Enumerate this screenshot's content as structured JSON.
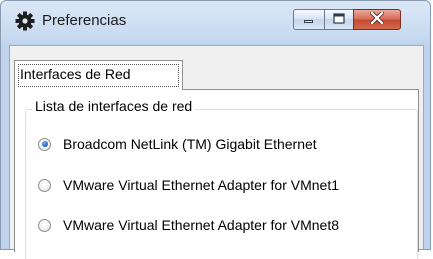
{
  "window": {
    "title": "Preferencias",
    "icon": "gear-icon",
    "controls": {
      "minimize": "minimize-icon",
      "maximize": "maximize-icon",
      "close": "close-icon"
    }
  },
  "tabs": [
    {
      "label": "Interfaces de Red",
      "selected": true
    }
  ],
  "group": {
    "legend": "Lista de interfaces de red",
    "options": [
      {
        "label": "Broadcom NetLink (TM) Gigabit Ethernet",
        "checked": true
      },
      {
        "label": "VMware Virtual Ethernet Adapter for VMnet1",
        "checked": false
      },
      {
        "label": "VMware Virtual Ethernet Adapter for VMnet8",
        "checked": false
      }
    ]
  },
  "colors": {
    "titlebar": "#c9dbf1",
    "close_button": "#c44a32",
    "radio_selected": "#2a6bc4"
  }
}
